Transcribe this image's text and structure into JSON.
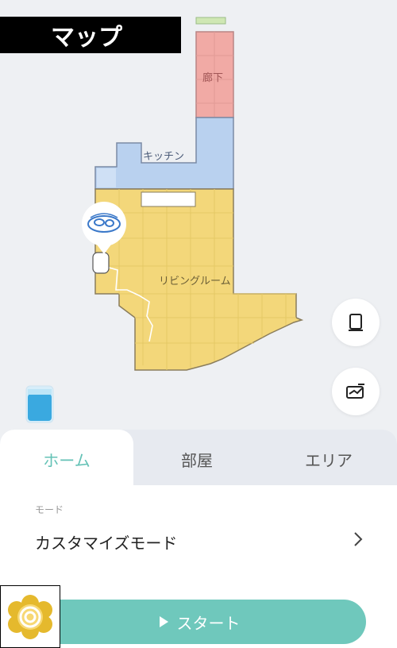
{
  "header": {
    "title": "マップ"
  },
  "map": {
    "rooms": {
      "corridor": "廊下",
      "kitchen": "キッチン",
      "living": "リビングルーム"
    }
  },
  "tabs": {
    "home": "ホーム",
    "room": "部屋",
    "area": "エリア",
    "active": "ホーム"
  },
  "mode": {
    "caption": "モード",
    "value": "カスタマイズモード"
  },
  "start": {
    "label": "スタート"
  },
  "icons": {
    "side_top": "map-book-icon",
    "side_bottom": "map-edit-icon",
    "tank": "water-tank-icon",
    "start": "play-icon",
    "chevron": "chevron-right-icon"
  },
  "colors": {
    "accent": "#6fc8bc",
    "corridor": "#f1aaa5",
    "kitchen": "#b9d1ef",
    "living": "#f3d77a"
  }
}
